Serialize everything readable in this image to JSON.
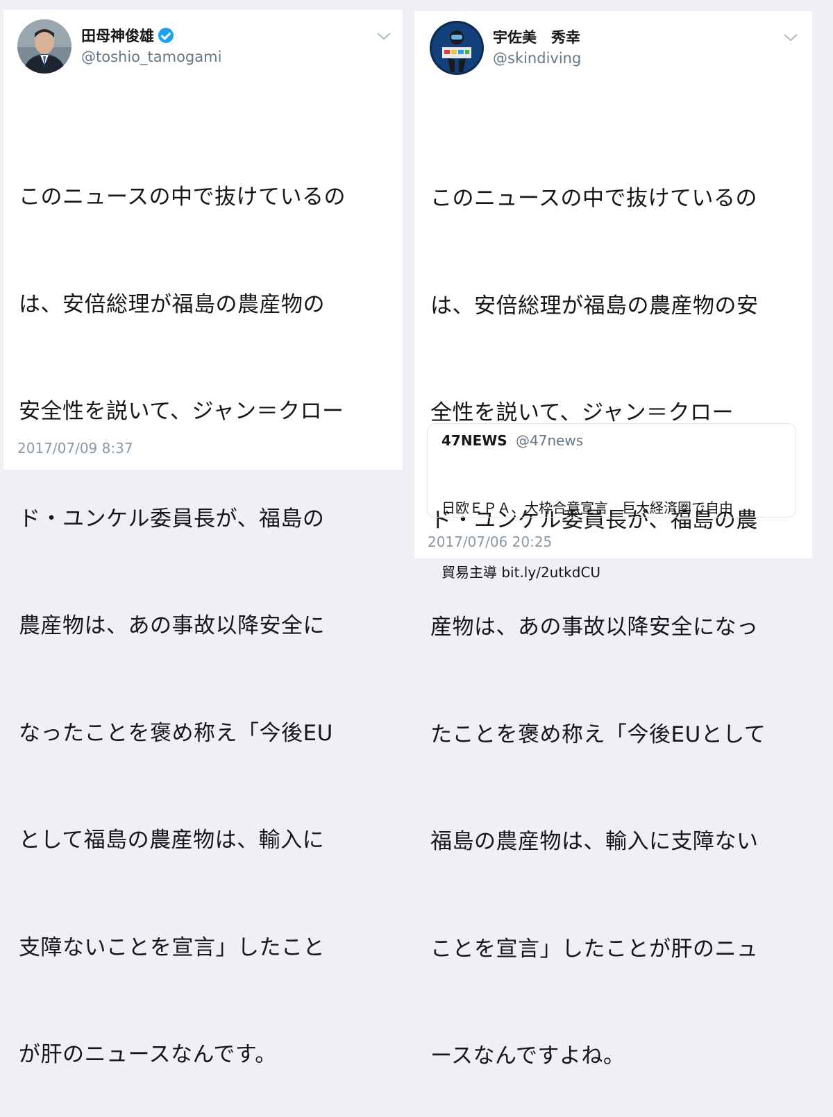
{
  "tweets": [
    {
      "author_name": "田母神俊雄",
      "verified": true,
      "handle": "@toshio_tamogami",
      "text_lines": [
        "このニュースの中で抜けているの",
        "は、安倍総理が福島の農産物の",
        "安全性を説いて、ジャン＝クロー",
        "ド・ユンケル委員長が、福島の",
        "農産物は、あの事故以降安全に",
        "なったことを褒め称え「今後EU",
        "として福島の農産物は、輸入に",
        "支障ないことを宣言」したこと",
        "が肝のニュースなんです。"
      ],
      "timestamp": "2017/07/09 8:37",
      "avatar_icon": "portrait-avatar-icon",
      "menu_icon": "chevron-down-icon"
    },
    {
      "author_name": "宇佐美　秀幸",
      "verified": false,
      "handle": "@skindiving",
      "text_lines": [
        "このニュースの中で抜けているの",
        "は、安倍総理が福島の農産物の安",
        "全性を説いて、ジャン＝クロー",
        "ド・ユンケル委員長が、福島の農",
        "産物は、あの事故以降安全になっ",
        "たことを褒め称え「今後EUとして",
        "福島の農産物は、輸入に支障ない",
        "ことを宣言」したことが肝のニュ",
        "ースなんですよね。"
      ],
      "quoted": {
        "name": "47NEWS",
        "handle": "@47news",
        "text_lines": [
          "日欧ＥＰＡ、大枠合意宣言　巨大経済圏で自由",
          "貿易主導 bit.ly/2utkdCU"
        ]
      },
      "timestamp": "2017/07/06 20:25",
      "avatar_icon": "diver-avatar-icon",
      "menu_icon": "chevron-down-icon"
    }
  ],
  "colors": {
    "background": "#efeff4",
    "card": "#ffffff",
    "text": "#14171a",
    "handle": "#657786",
    "timestamp": "#8899a6",
    "verified": "#1da1f2"
  }
}
